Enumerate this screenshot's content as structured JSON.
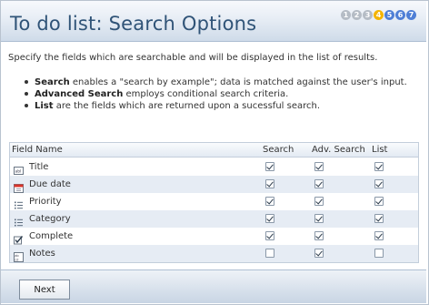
{
  "header": {
    "title": "To do list: Search Options",
    "steps": [
      {
        "label": "1",
        "color": "#b5bcc5"
      },
      {
        "label": "2",
        "color": "#b5bcc5"
      },
      {
        "label": "3",
        "color": "#b5bcc5"
      },
      {
        "label": "4",
        "color": "#f4b400"
      },
      {
        "label": "5",
        "color": "#4f7fd6"
      },
      {
        "label": "6",
        "color": "#4f7fd6"
      },
      {
        "label": "7",
        "color": "#4f7fd6"
      }
    ],
    "current_step": "4"
  },
  "intro": "Specify the fields which are searchable and will be displayed in the list of results.",
  "bullets": [
    {
      "term": "Search",
      "text": " enables a \"search by example\"; data is matched against the user's input."
    },
    {
      "term": "Advanced Search",
      "text": " employs conditional search criteria."
    },
    {
      "term": "List",
      "text": " are the fields which are returned upon a sucessful search."
    }
  ],
  "grid": {
    "columns": {
      "field": "Field Name",
      "search": "Search",
      "adv": "Adv. Search",
      "list": "List"
    },
    "rows": [
      {
        "name": "Title",
        "icon": "text-field-icon",
        "search": true,
        "adv": true,
        "list": true
      },
      {
        "name": "Due date",
        "icon": "calendar-icon",
        "search": true,
        "adv": true,
        "list": true
      },
      {
        "name": "Priority",
        "icon": "list-icon",
        "search": true,
        "adv": true,
        "list": true
      },
      {
        "name": "Category",
        "icon": "list-icon",
        "search": true,
        "adv": true,
        "list": true
      },
      {
        "name": "Complete",
        "icon": "checkbox-icon",
        "search": true,
        "adv": true,
        "list": true
      },
      {
        "name": "Notes",
        "icon": "memo-icon",
        "search": false,
        "adv": true,
        "list": false
      }
    ]
  },
  "footer": {
    "next_label": "Next"
  }
}
